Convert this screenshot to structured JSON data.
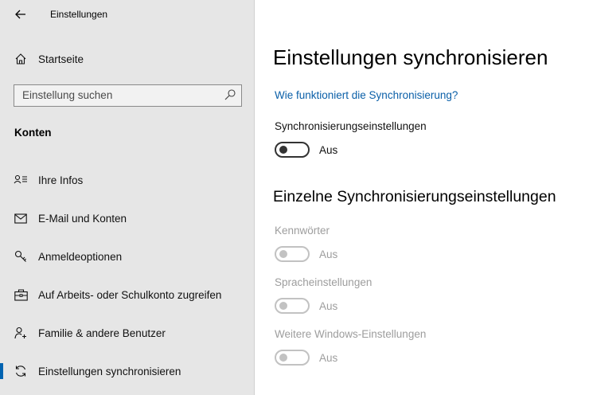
{
  "titlebar": {
    "app_title": "Einstellungen"
  },
  "sidebar": {
    "home_label": "Startseite",
    "search": {
      "placeholder": "Einstellung suchen",
      "value": ""
    },
    "section_heading": "Konten",
    "items": [
      {
        "label": "Ihre Infos",
        "icon": "person-card-icon",
        "active": false
      },
      {
        "label": "E-Mail und Konten",
        "icon": "mail-icon",
        "active": false
      },
      {
        "label": "Anmeldeoptionen",
        "icon": "key-icon",
        "active": false
      },
      {
        "label": "Auf Arbeits- oder Schulkonto zugreifen",
        "icon": "briefcase-icon",
        "active": false
      },
      {
        "label": "Familie & andere Benutzer",
        "icon": "person-add-icon",
        "active": false
      },
      {
        "label": "Einstellungen synchronisieren",
        "icon": "sync-icon",
        "active": true
      }
    ]
  },
  "main": {
    "title": "Einstellungen synchronisieren",
    "help_link": "Wie funktioniert die Synchronisierung?",
    "master_sync": {
      "label": "Synchronisierungseinstellungen",
      "state": "Aus",
      "on": false,
      "enabled": true
    },
    "individual_title": "Einzelne Synchronisierungseinstellungen",
    "individual": [
      {
        "label": "Kennwörter",
        "state": "Aus",
        "on": false,
        "enabled": false
      },
      {
        "label": "Spracheinstellungen",
        "state": "Aus",
        "on": false,
        "enabled": false
      },
      {
        "label": "Weitere Windows-Einstellungen",
        "state": "Aus",
        "on": false,
        "enabled": false
      }
    ]
  },
  "colors": {
    "accent": "#0063b1",
    "link": "#0a5fa8",
    "sidebar_bg": "#e6e6e6",
    "disabled_text": "#9d9d9d"
  }
}
